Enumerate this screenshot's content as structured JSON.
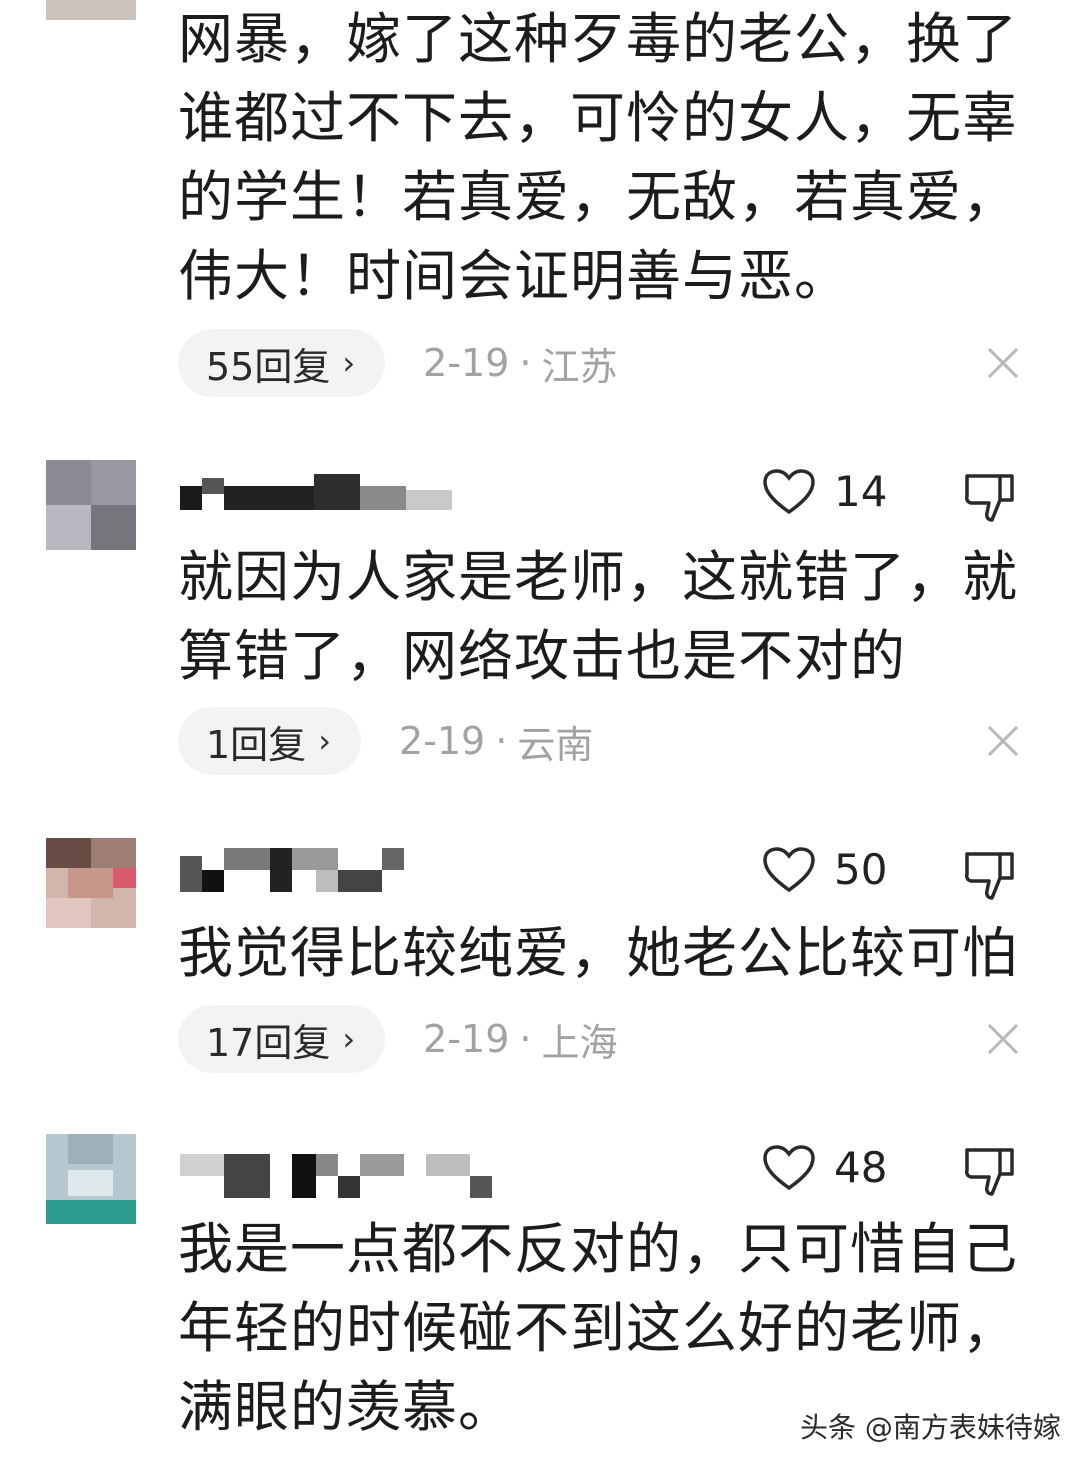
{
  "comments": [
    {
      "text": "网暴，嫁了这种歹毒的老公，换了谁都过不下去，可怜的女人，无辜的学生！若真爱，无敌，若真爱，伟大！时间会证明善与恶。",
      "replies": "55回复",
      "date": "2-19",
      "location": "江苏"
    },
    {
      "likes": "14",
      "text": "就因为人家是老师，这就错了，就算错了，网络攻击也是不对的",
      "replies": "1回复",
      "date": "2-19",
      "location": "云南"
    },
    {
      "likes": "50",
      "text": "我觉得比较纯爱，她老公比较可怕",
      "replies": "17回复",
      "date": "2-19",
      "location": "上海"
    },
    {
      "likes": "48",
      "text": "我是一点都不反对的，只可惜自己年轻的时候碰不到这么好的老师，满眼的羡慕。"
    }
  ],
  "icons": {
    "like": "heart-outline-icon",
    "dislike": "thumbs-down-outline-icon",
    "chevron": "chevron-right-icon",
    "close": "close-icon"
  },
  "watermark": "头条 @南方表妹待嫁",
  "colors": {
    "text": "#1c1c1c",
    "meta": "#a2a2a2",
    "pill_bg": "#f3f3f3"
  }
}
